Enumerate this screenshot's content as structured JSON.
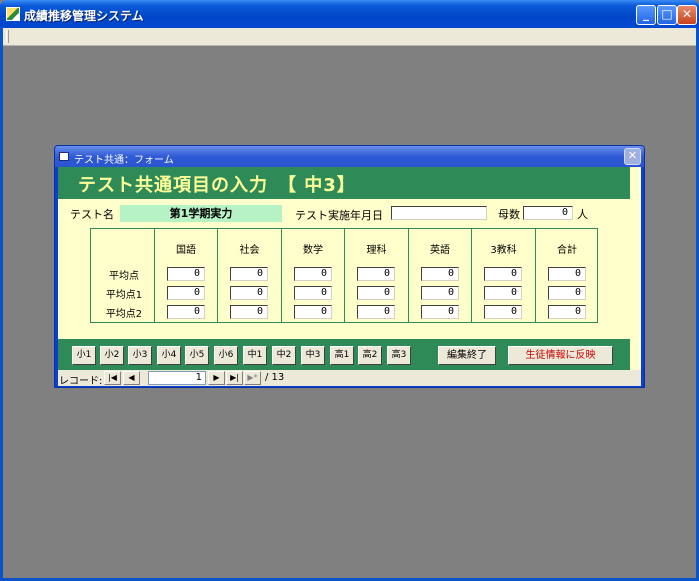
{
  "app": {
    "title": "成績推移管理システム",
    "minimize": "_",
    "maximize": "□",
    "close": "✕"
  },
  "form": {
    "window_title": "テスト共通：フォーム",
    "close": "✕",
    "header_title": "テスト共通項目の入力　【 中3】",
    "test_name_label": "テスト名",
    "test_name_value": "第1学期実力",
    "test_date_label": "テスト実施年月日",
    "test_date_value": "",
    "count_label": "母数",
    "count_value": "0",
    "count_unit": "人",
    "columns": [
      "国語",
      "社会",
      "数学",
      "理科",
      "英語",
      "3教科",
      "合計"
    ],
    "rows": [
      {
        "label": "平均点",
        "values": [
          "0",
          "0",
          "0",
          "0",
          "0",
          "0",
          "0"
        ]
      },
      {
        "label": "平均点1",
        "values": [
          "0",
          "0",
          "0",
          "0",
          "0",
          "0",
          "0"
        ]
      },
      {
        "label": "平均点2",
        "values": [
          "0",
          "0",
          "0",
          "0",
          "0",
          "0",
          "0"
        ]
      }
    ],
    "grade_buttons": [
      "小1",
      "小2",
      "小3",
      "小4",
      "小5",
      "小6",
      "中1",
      "中2",
      "中3",
      "高1",
      "高2",
      "高3"
    ],
    "finish_button": "編集終了",
    "reflect_button": "生徒情報に反映",
    "reflect_color": "#cc0000"
  },
  "record_nav": {
    "label": "レコード:",
    "first": "|◀",
    "prev": "◀",
    "current": "1",
    "next": "▶",
    "last": "▶|",
    "new": "▶*",
    "total": "/ 13"
  }
}
